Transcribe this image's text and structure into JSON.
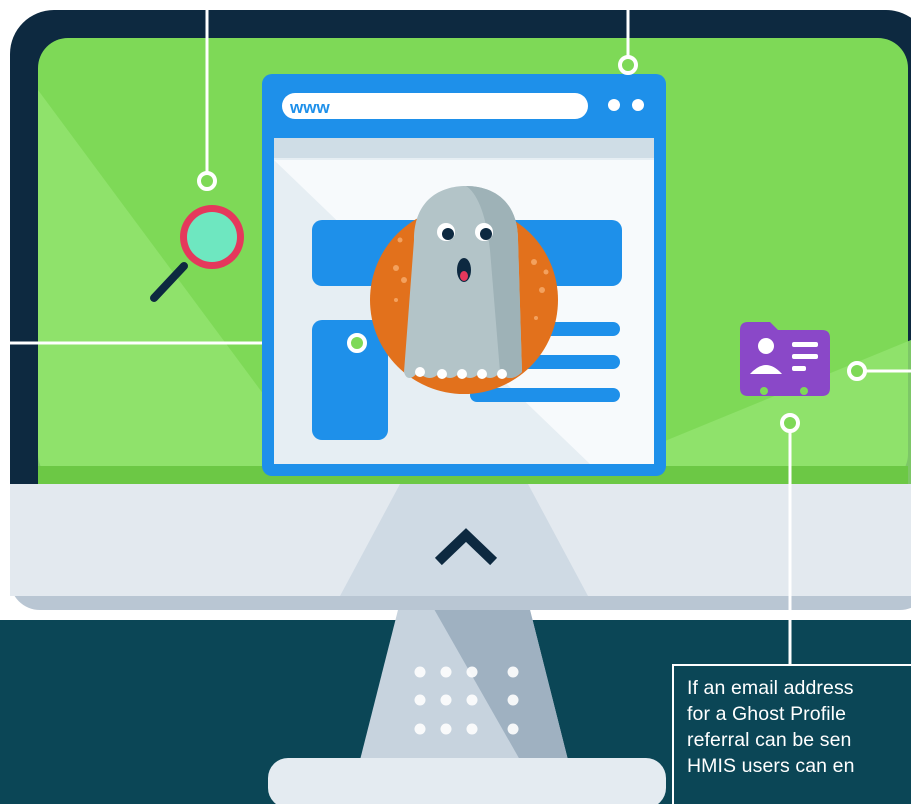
{
  "browser": {
    "url_label": "www"
  },
  "callout": {
    "lines": [
      "If an email address",
      "for a Ghost Profile",
      "referral can be sen",
      "HMIS users can en"
    ]
  },
  "colors": {
    "background_bottom": "#0b4656",
    "monitor_bezel": "#0d2940",
    "screen_green": "#7ed957",
    "browser_blue": "#1e90ea",
    "ghost_orange": "#e2711c",
    "folder_purple": "#8a48c8",
    "magnifier_red": "#e5385c"
  },
  "icons": [
    "magnifier-icon",
    "ghost-icon",
    "contact-folder-icon",
    "chevron-up-icon",
    "callout-pin-icon"
  ]
}
